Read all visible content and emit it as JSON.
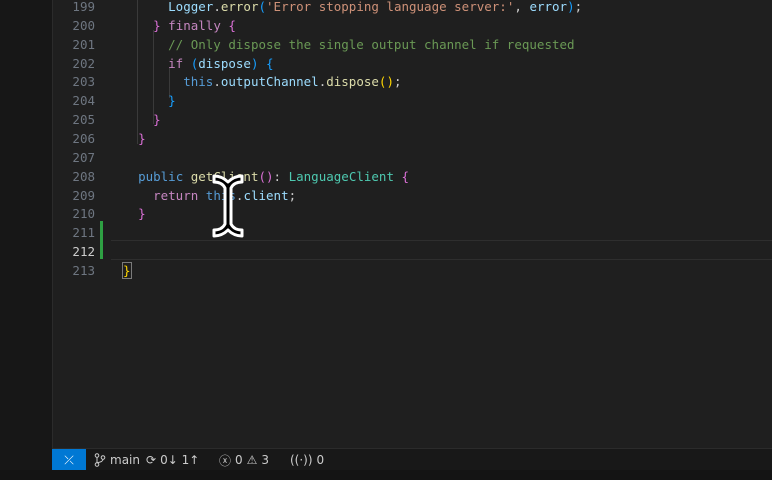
{
  "editor": {
    "lines": [
      {
        "num": "199",
        "tokens": [
          {
            "t": "      "
          },
          {
            "t": "Logger",
            "c": "var"
          },
          {
            "t": "."
          },
          {
            "t": "error",
            "c": "fn"
          },
          {
            "t": "(",
            "c": "b3"
          },
          {
            "t": "'Error stopping language server:'",
            "c": "str"
          },
          {
            "t": ", "
          },
          {
            "t": "error",
            "c": "var"
          },
          {
            "t": ")",
            "c": "b3"
          },
          {
            "t": ";"
          }
        ]
      },
      {
        "num": "200",
        "tokens": [
          {
            "t": "    "
          },
          {
            "t": "}",
            "c": "b2"
          },
          {
            "t": " "
          },
          {
            "t": "finally",
            "c": "kw"
          },
          {
            "t": " "
          },
          {
            "t": "{",
            "c": "b2"
          }
        ]
      },
      {
        "num": "201",
        "tokens": [
          {
            "t": "      "
          },
          {
            "t": "// Only dispose the single output channel if requested",
            "c": "cm"
          }
        ]
      },
      {
        "num": "202",
        "tokens": [
          {
            "t": "      "
          },
          {
            "t": "if",
            "c": "kw"
          },
          {
            "t": " "
          },
          {
            "t": "(",
            "c": "b3"
          },
          {
            "t": "dispose",
            "c": "var"
          },
          {
            "t": ")",
            "c": "b3"
          },
          {
            "t": " "
          },
          {
            "t": "{",
            "c": "b3"
          }
        ]
      },
      {
        "num": "203",
        "tokens": [
          {
            "t": "        "
          },
          {
            "t": "this",
            "c": "kw2"
          },
          {
            "t": "."
          },
          {
            "t": "outputChannel",
            "c": "var"
          },
          {
            "t": "."
          },
          {
            "t": "dispose",
            "c": "fn"
          },
          {
            "t": "(",
            "c": "b1"
          },
          {
            "t": ")",
            "c": "b1"
          },
          {
            "t": ";"
          }
        ]
      },
      {
        "num": "204",
        "tokens": [
          {
            "t": "      "
          },
          {
            "t": "}",
            "c": "b3"
          }
        ]
      },
      {
        "num": "205",
        "tokens": [
          {
            "t": "    "
          },
          {
            "t": "}",
            "c": "b2"
          }
        ]
      },
      {
        "num": "206",
        "tokens": [
          {
            "t": "  "
          },
          {
            "t": "}",
            "c": "b2"
          }
        ]
      },
      {
        "num": "207",
        "tokens": []
      },
      {
        "num": "208",
        "tokens": [
          {
            "t": "  "
          },
          {
            "t": "public",
            "c": "kw2"
          },
          {
            "t": " "
          },
          {
            "t": "getClient",
            "c": "fn"
          },
          {
            "t": "(",
            "c": "b2"
          },
          {
            "t": ")",
            "c": "b2"
          },
          {
            "t": ": "
          },
          {
            "t": "LanguageClient",
            "c": "type"
          },
          {
            "t": " "
          },
          {
            "t": "{",
            "c": "b2"
          }
        ]
      },
      {
        "num": "209",
        "tokens": [
          {
            "t": "    "
          },
          {
            "t": "return",
            "c": "kw"
          },
          {
            "t": " "
          },
          {
            "t": "this",
            "c": "kw2"
          },
          {
            "t": "."
          },
          {
            "t": "client",
            "c": "var"
          },
          {
            "t": ";"
          }
        ]
      },
      {
        "num": "210",
        "tokens": [
          {
            "t": "  "
          },
          {
            "t": "}",
            "c": "b2"
          }
        ]
      },
      {
        "num": "211",
        "tokens": []
      },
      {
        "num": "212",
        "tokens": []
      },
      {
        "num": "213",
        "tokens": [
          {
            "t": "}",
            "c": "b1",
            "hl": true
          }
        ]
      }
    ]
  },
  "statusbar": {
    "branch": "main",
    "sync": "0↓ 1↑",
    "errors": "0",
    "warnings": "3",
    "ports": "0"
  }
}
